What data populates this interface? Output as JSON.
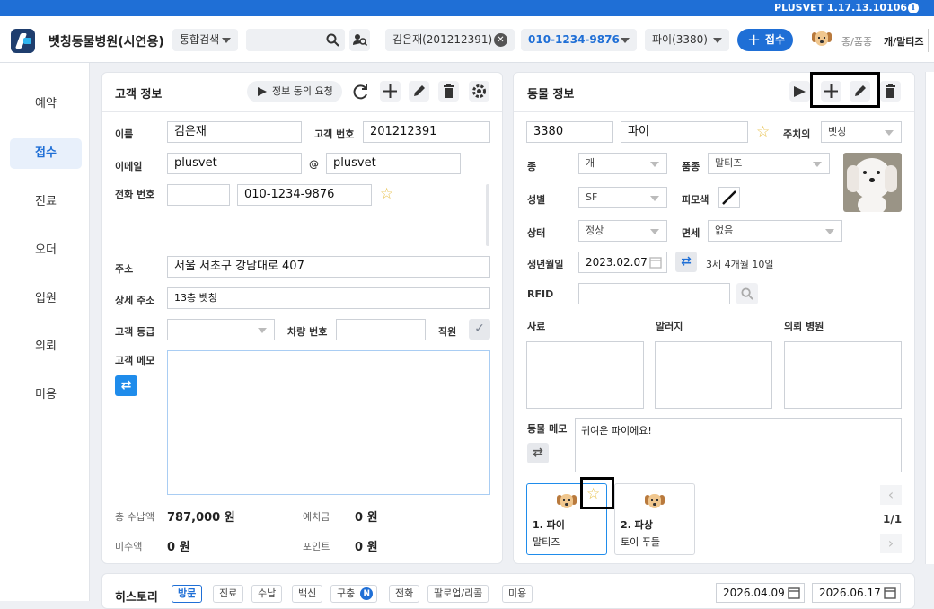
{
  "app": {
    "version": "PLUSVET 1.17.13.10106",
    "hospital_name": "벳칭동물병원(시연용)"
  },
  "header": {
    "search_mode": "통합검색",
    "search_placeholder": "",
    "customer": "김은재(201212391)",
    "phone": "010-1234-9876",
    "pet": "파이(3380)",
    "accept_label": "접수",
    "species_label": "종/품종",
    "species_value": "개/말티즈"
  },
  "sidebar": {
    "items": [
      {
        "label": "예약"
      },
      {
        "label": "접수"
      },
      {
        "label": "진료"
      },
      {
        "label": "오더"
      },
      {
        "label": "입원"
      },
      {
        "label": "의뢰"
      },
      {
        "label": "미용"
      }
    ]
  },
  "customer": {
    "title": "고객 정보",
    "consent_btn": "정보 동의 요청",
    "name_label": "이름",
    "name": "김은재",
    "no_label": "고객 번호",
    "no": "201212391",
    "email_label": "이메일",
    "email_id": "plusvet",
    "at": "@",
    "email_domain": "plusvet",
    "phone_label": "전화 번호",
    "phone_prefix": "",
    "phone": "010-1234-9876",
    "addr_label": "주소",
    "addr": "서울 서초구 강남대로 407",
    "addr2_label": "상세 주소",
    "addr2": "13층 벳칭",
    "grade_label": "고객 등급",
    "car_label": "차량 번호",
    "staff_label": "직원",
    "memo_label": "고객 메모",
    "total_label": "총 수납액",
    "total": "787,000 원",
    "deposit_label": "예치금",
    "deposit": "0 원",
    "unpaid_label": "미수액",
    "unpaid": "0 원",
    "point_label": "포인트",
    "point": "0 원"
  },
  "animal": {
    "title": "동물 정보",
    "id": "3380",
    "name": "파이",
    "doctor_label": "주치의",
    "doctor": "벳칭",
    "species_label": "종",
    "species": "개",
    "breed_label": "품종",
    "breed": "말티즈",
    "sex_label": "성별",
    "sex": "SF",
    "color_label": "피모색",
    "status_label": "상태",
    "status": "정상",
    "exempt_label": "면세",
    "exempt": "없음",
    "dob_label": "생년월일",
    "dob": "2023.02.07",
    "age": "3세 4개월 10일",
    "rfid_label": "RFID",
    "feed_label": "사료",
    "allergy_label": "알러지",
    "ref_label": "의뢰 병원",
    "memo_label": "동물 메모",
    "memo": "귀여운 파이에요!",
    "pets": [
      {
        "label": "1. 파이",
        "breed": "말티즈"
      },
      {
        "label": "2. 파상",
        "breed": "토이 푸들"
      }
    ],
    "page": "1/1"
  },
  "history": {
    "title": "히스토리",
    "tabs": [
      {
        "label": "방문"
      },
      {
        "label": "진료"
      },
      {
        "label": "수납"
      },
      {
        "label": "백신"
      },
      {
        "label": "구충"
      },
      {
        "label": "전화"
      },
      {
        "label": "팔로업/리콜"
      },
      {
        "label": "미용"
      }
    ],
    "badge": "N",
    "date_from": "2026.04.09",
    "date_to": "2026.06.17"
  },
  "colors": {
    "accent": "#1f6fd6",
    "star": "#e8c24e"
  }
}
